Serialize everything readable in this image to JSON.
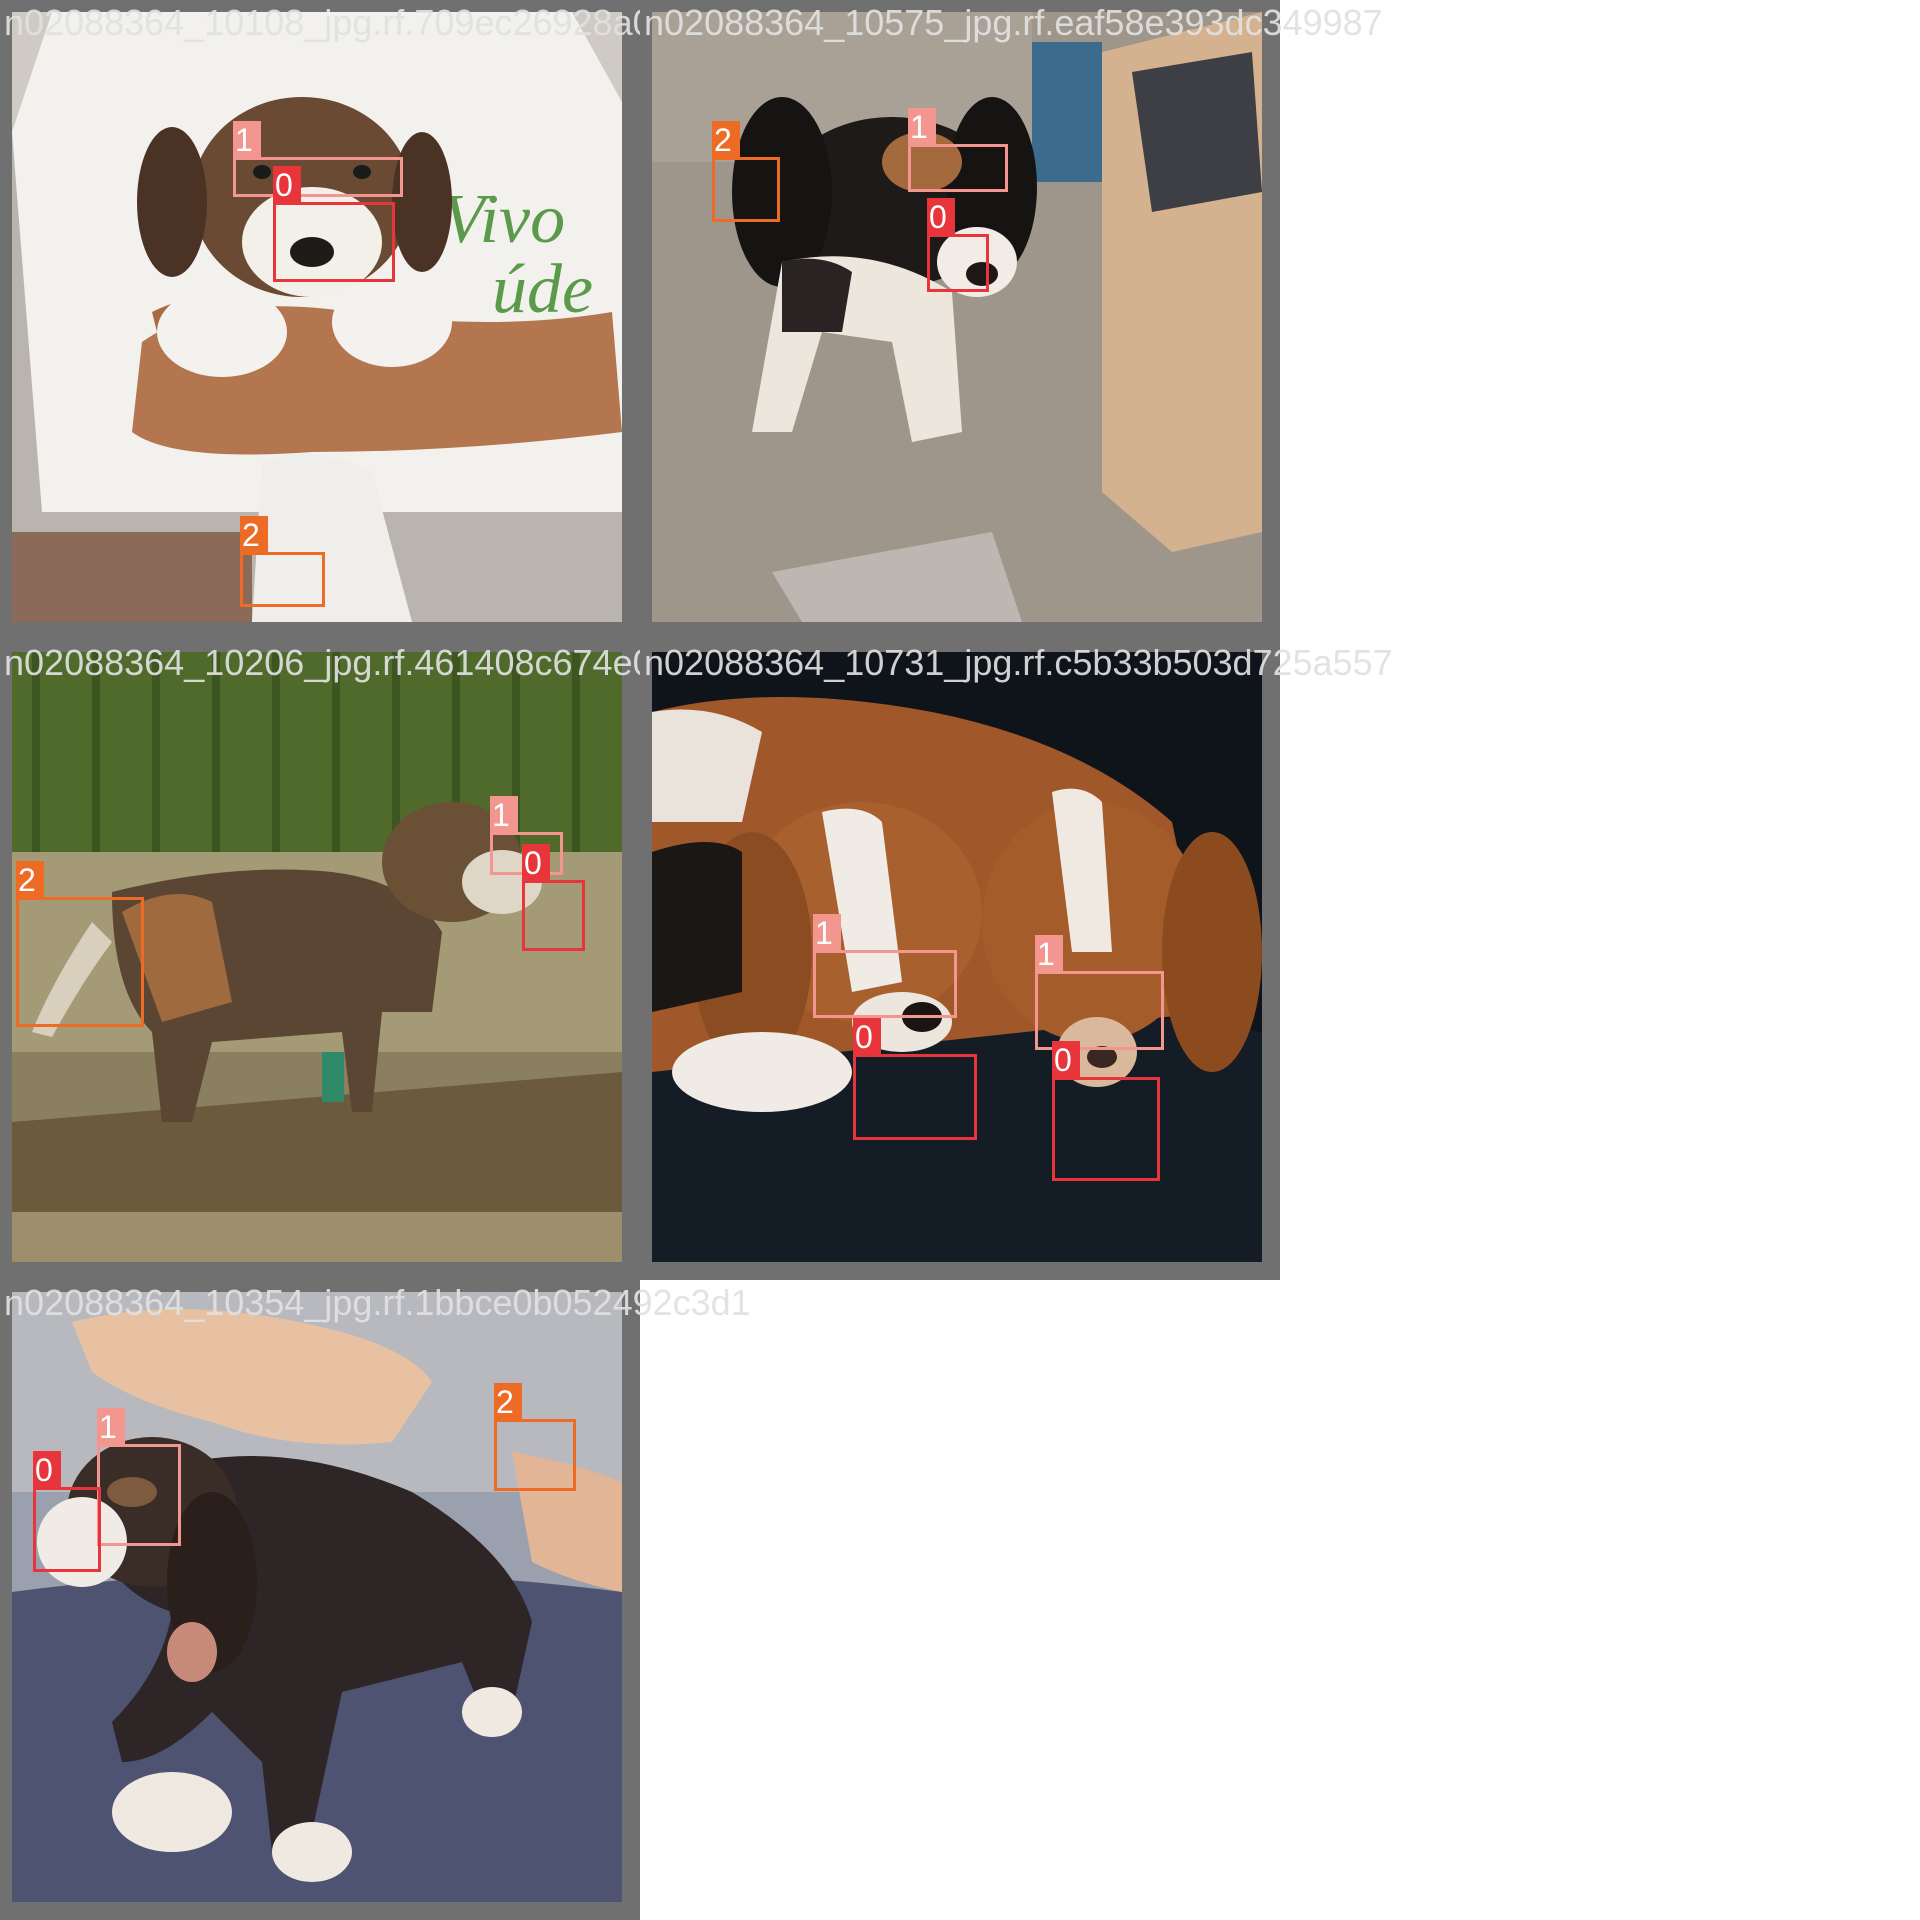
{
  "class_colors": {
    "0": "#e8353b",
    "1": "#f2968f",
    "2": "#ee6b26"
  },
  "tiles": [
    {
      "filename": "n02088364_10108_jpg.rf.709ec26928a02f2833",
      "scene": "beagle puppy held by a person in a white t-shirt",
      "labels": [
        "1",
        "0",
        "2"
      ]
    },
    {
      "filename": "n02088364_10575_jpg.rf.eaf58e393dc349987",
      "scene": "tricolor hound standing on beige carpet near a desk",
      "labels": [
        "2",
        "1",
        "0"
      ]
    },
    {
      "filename": "n02088364_10206_jpg.rf.461408c674e0208b",
      "scene": "beagle standing on gravel in front of a wooden fence at night",
      "labels": [
        "1",
        "0",
        "2"
      ]
    },
    {
      "filename": "n02088364_10731_jpg.rf.c5b33b503d725a557",
      "scene": "two basset hounds lying on a black leather couch",
      "labels": [
        "1",
        "0",
        "1",
        "0"
      ]
    },
    {
      "filename": "n02088364_10354_jpg.rf.1bbce0b052492c3d1",
      "scene": "tricolor beagle puppy on a blue blanket being petted",
      "labels": [
        "2",
        "1",
        "0"
      ]
    }
  ]
}
